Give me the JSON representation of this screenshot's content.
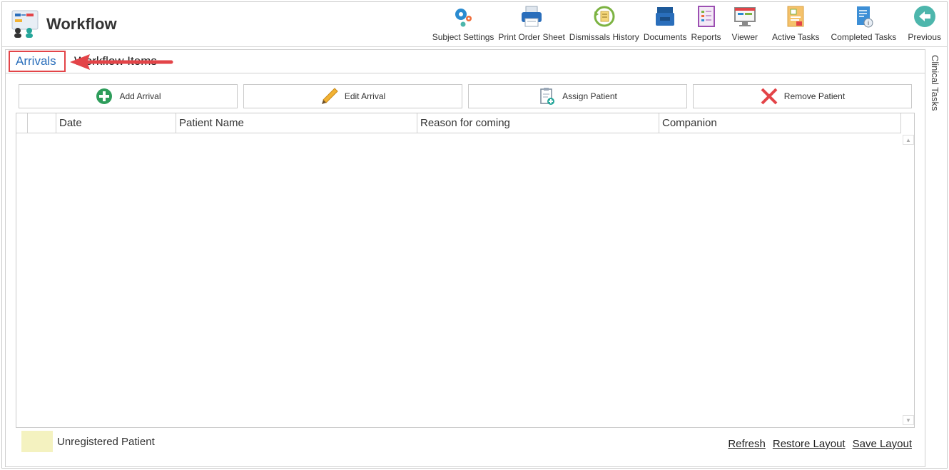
{
  "app": {
    "title": "Workflow",
    "logo_icon": "workflow-logo-icon"
  },
  "toolbar": {
    "items": [
      {
        "label": "Subject Settings",
        "icon": "gears-icon"
      },
      {
        "label": "Print Order Sheet",
        "icon": "printer-icon"
      },
      {
        "label": "Dismissals History",
        "icon": "history-icon"
      },
      {
        "label": "Documents",
        "icon": "inbox-tray-icon"
      },
      {
        "label": "Reports",
        "icon": "report-icon"
      },
      {
        "label": "Viewer",
        "icon": "monitor-icon"
      },
      {
        "label": "Active Tasks",
        "icon": "active-tasks-icon"
      },
      {
        "label": "Completed Tasks",
        "icon": "completed-tasks-icon"
      },
      {
        "label": "Previous",
        "icon": "back-arrow-icon"
      }
    ]
  },
  "tabs": [
    {
      "label": "Arrivals",
      "active": true
    },
    {
      "label": "Workflow Items",
      "active": false
    }
  ],
  "actions": {
    "add": "Add Arrival",
    "edit": "Edit Arrival",
    "assign": "Assign Patient",
    "remove": "Remove Patient"
  },
  "grid": {
    "columns": [
      "",
      "",
      "Date",
      "Patient Name",
      "Reason for coming",
      "Companion"
    ],
    "rows": []
  },
  "legend": {
    "label": "Unregistered Patient",
    "color": "#f4f2c0"
  },
  "footer_links": {
    "refresh": "Refresh",
    "restore": "Restore Layout",
    "save": "Save Layout"
  },
  "side_panel": {
    "label": "Clinical Tasks"
  },
  "colors": {
    "accent": "#2a6ebb",
    "highlight": "#e34448"
  }
}
